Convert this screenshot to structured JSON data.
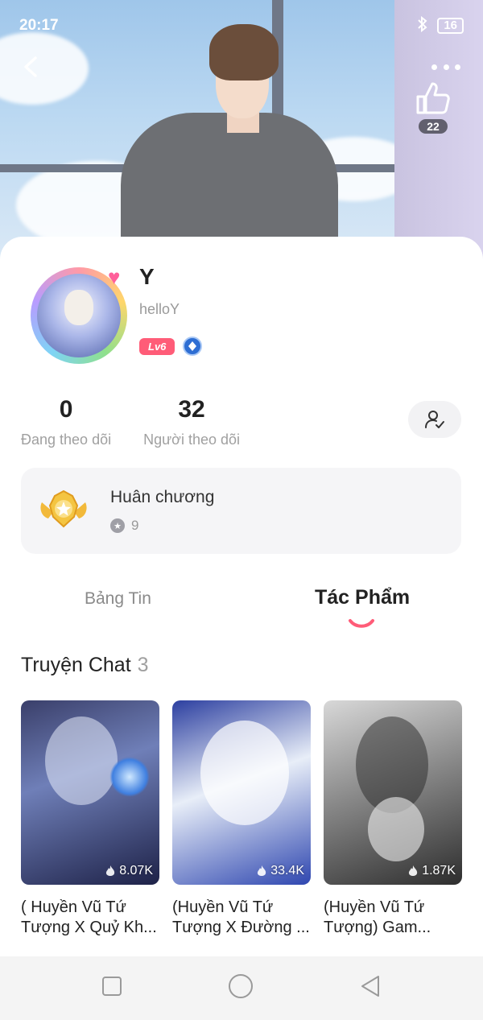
{
  "status_bar": {
    "time": "20:17",
    "battery": "16"
  },
  "hero": {
    "like_count": "22"
  },
  "profile": {
    "name": "Y",
    "handle": "helloY",
    "level_badge": "Lv6",
    "following_count": "0",
    "following_label": "Đang theo dõi",
    "followers_count": "32",
    "followers_label": "Người theo dõi"
  },
  "medals": {
    "title": "Huân chương",
    "count": "9"
  },
  "tabs": [
    {
      "label": "Bảng Tin",
      "active": false
    },
    {
      "label": "Tác Phẩm",
      "active": true
    }
  ],
  "section": {
    "title": "Truyện Chat",
    "count": "3"
  },
  "works": [
    {
      "title": "( Huyền Vũ Tứ Tượng X Quỷ Kh...",
      "views": "8.07K"
    },
    {
      "title": "(Huyền Vũ Tứ Tượng X Đường ...",
      "views": "33.4K"
    },
    {
      "title": "(Huyền Vũ Tứ Tượng) Gam...",
      "views": "1.87K"
    }
  ],
  "icons": {
    "back": "chevron-left-icon",
    "more": "more-dots-icon",
    "like": "thumbs-up-icon",
    "follow": "person-check-icon",
    "medal": "medal-icon",
    "views": "fire-icon"
  },
  "colors": {
    "accent": "#ff5c78",
    "level_badge": "#ff5c78",
    "gem": "#2e6ed3"
  }
}
